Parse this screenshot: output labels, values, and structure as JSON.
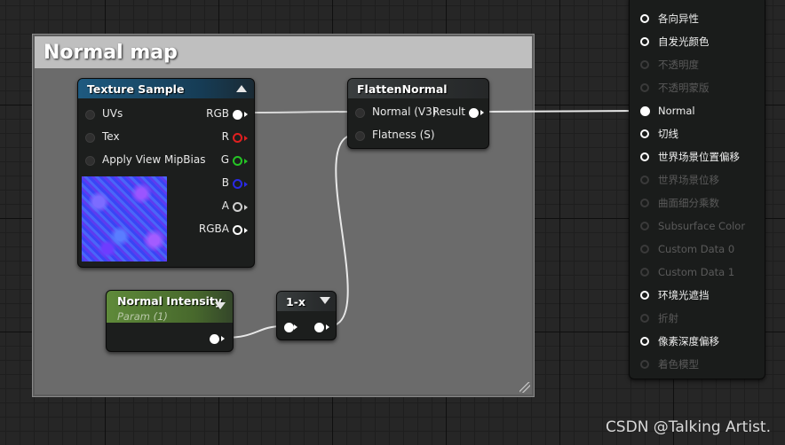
{
  "comment": {
    "title": "Normal map"
  },
  "texture_sample": {
    "title": "Texture Sample",
    "inputs": [
      "UVs",
      "Tex",
      "Apply View MipBias"
    ],
    "outputs": [
      {
        "label": "RGB",
        "color": "#ffffff"
      },
      {
        "label": "R",
        "color": "#e02020"
      },
      {
        "label": "G",
        "color": "#25c425"
      },
      {
        "label": "B",
        "color": "#2a2ae6"
      },
      {
        "label": "A",
        "color": "#cfcfcf"
      },
      {
        "label": "RGBA",
        "color": "#ffffff"
      }
    ]
  },
  "flatten_normal": {
    "title": "FlattenNormal",
    "inputs": [
      "Normal (V3)",
      "Flatness (S)"
    ],
    "output": "Result"
  },
  "normal_intensity": {
    "title": "Normal Intensity",
    "subtitle": "Param (1)"
  },
  "one_minus": {
    "title": "1-x"
  },
  "material": {
    "pins": [
      {
        "label": "各向异性",
        "active": true
      },
      {
        "label": "自发光颜色",
        "active": true
      },
      {
        "label": "不透明度",
        "active": false
      },
      {
        "label": "不透明蒙版",
        "active": false
      },
      {
        "label": "Normal",
        "active": true,
        "connected": true
      },
      {
        "label": "切线",
        "active": true
      },
      {
        "label": "世界场景位置偏移",
        "active": true
      },
      {
        "label": "世界场景位移",
        "active": false
      },
      {
        "label": "曲面细分乘数",
        "active": false
      },
      {
        "label": "Subsurface Color",
        "active": false
      },
      {
        "label": "Custom Data 0",
        "active": false
      },
      {
        "label": "Custom Data 1",
        "active": false
      },
      {
        "label": "环境光遮挡",
        "active": true
      },
      {
        "label": "折射",
        "active": false
      },
      {
        "label": "像素深度偏移",
        "active": true
      },
      {
        "label": "着色模型",
        "active": false
      }
    ]
  },
  "watermark": "CSDN @Talking Artist."
}
